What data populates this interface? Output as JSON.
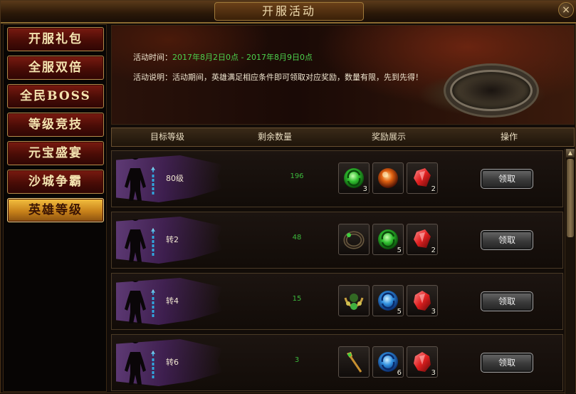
{
  "window": {
    "title": "开服活动",
    "close_label": "×"
  },
  "sidebar": {
    "items": [
      {
        "label": "开服礼包",
        "active": false
      },
      {
        "label": "全服双倍",
        "active": false
      },
      {
        "label": "全民BOSS",
        "active": false
      },
      {
        "label": "等级竞技",
        "active": false
      },
      {
        "label": "元宝盛宴",
        "active": false
      },
      {
        "label": "沙城争霸",
        "active": false
      },
      {
        "label": "英雄等级",
        "active": true
      }
    ]
  },
  "banner": {
    "time_label": "活动时间：",
    "time_value": "2017年8月2日0点 - 2017年8月9日0点",
    "desc_label": "活动说明：",
    "desc_value": "活动期间，英雄满足相应条件即可领取对应奖励，数量有限，先到先得！"
  },
  "table": {
    "headers": [
      "目标等级",
      "剩余数量",
      "奖励展示",
      "操作"
    ],
    "rows": [
      {
        "level": "80级",
        "remaining": "196",
        "button": "领取",
        "rewards": [
          {
            "icon": "green-orb-icon",
            "count": "3"
          },
          {
            "icon": "fire-orb-icon",
            "count": ""
          },
          {
            "icon": "red-crystal-icon",
            "count": "2"
          }
        ]
      },
      {
        "level": "转2",
        "remaining": "48",
        "button": "领取",
        "rewards": [
          {
            "icon": "ring-icon",
            "count": ""
          },
          {
            "icon": "green-orb-icon",
            "count": "5"
          },
          {
            "icon": "red-crystal-icon",
            "count": "2"
          }
        ]
      },
      {
        "level": "转4",
        "remaining": "15",
        "button": "领取",
        "rewards": [
          {
            "icon": "necklace-icon",
            "count": ""
          },
          {
            "icon": "blue-orb-icon",
            "count": "5"
          },
          {
            "icon": "red-crystal-icon",
            "count": "3"
          }
        ]
      },
      {
        "level": "转6",
        "remaining": "3",
        "button": "领取",
        "rewards": [
          {
            "icon": "scepter-icon",
            "count": ""
          },
          {
            "icon": "blue-orb-icon",
            "count": "6"
          },
          {
            "icon": "red-crystal-icon",
            "count": "3"
          }
        ]
      }
    ]
  },
  "colors": {
    "accent_gold": "#f4c040",
    "button_red": "#7a1a10",
    "remaining_green": "#3cb83c",
    "time_green": "#4cd04c"
  }
}
